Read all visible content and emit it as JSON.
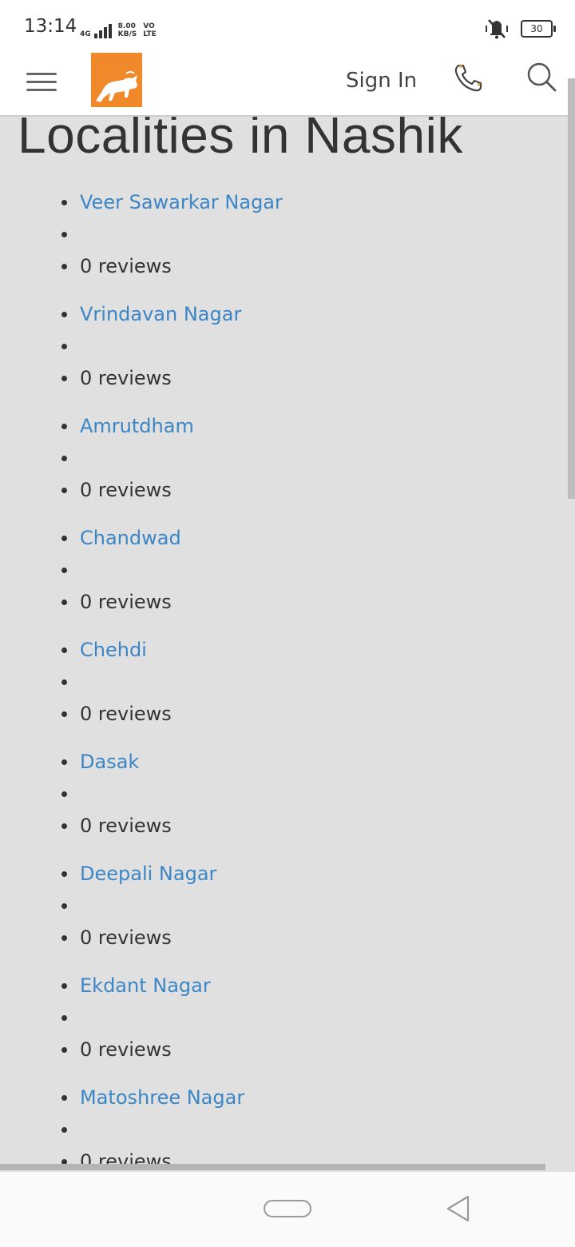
{
  "status_bar": {
    "time": "13:14",
    "net_type": "4G",
    "speed_value": "8.00",
    "speed_unit": "KB/S",
    "volte_top": "VO",
    "volte_bottom": "LTE",
    "battery": "30"
  },
  "header": {
    "sign_in_label": "Sign In"
  },
  "page": {
    "title": "Localities in Nashik",
    "localities": [
      {
        "name": "Veer Sawarkar Nagar",
        "empty": "",
        "reviews": "0 reviews"
      },
      {
        "name": "Vrindavan Nagar",
        "empty": "",
        "reviews": "0 reviews"
      },
      {
        "name": "Amrutdham",
        "empty": "",
        "reviews": "0 reviews"
      },
      {
        "name": "Chandwad",
        "empty": "",
        "reviews": "0 reviews"
      },
      {
        "name": "Chehdi",
        "empty": "",
        "reviews": "0 reviews"
      },
      {
        "name": "Dasak",
        "empty": "",
        "reviews": "0 reviews"
      },
      {
        "name": "Deepali Nagar",
        "empty": "",
        "reviews": "0 reviews"
      },
      {
        "name": "Ekdant Nagar",
        "empty": "",
        "reviews": "0 reviews"
      },
      {
        "name": "Matoshree Nagar",
        "empty": "",
        "reviews": "0 reviews"
      }
    ]
  },
  "colors": {
    "accent_link": "#3b86c6",
    "logo_orange": "#f0892a",
    "content_bg": "#e0e0e0"
  },
  "icons": [
    "hamburger-menu-icon",
    "logo-lion-icon",
    "phone-icon",
    "search-icon",
    "mute-vibrate-icon",
    "battery-icon",
    "home-pill-icon",
    "back-triangle-icon"
  ]
}
